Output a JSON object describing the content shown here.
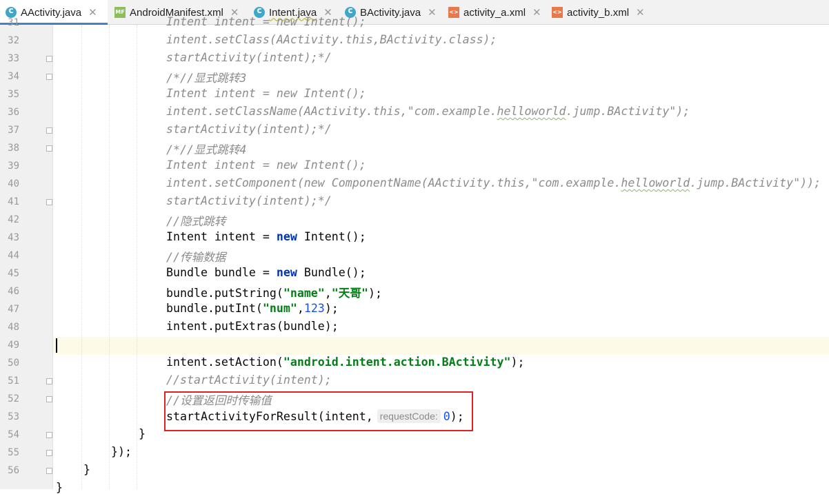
{
  "tabs": [
    {
      "label": "AActivity.java",
      "icon": "java-class-icon",
      "active": true
    },
    {
      "label": "AndroidManifest.xml",
      "icon": "manifest-file-icon",
      "active": false
    },
    {
      "label": "Intent.java",
      "icon": "java-class-icon",
      "active": false
    },
    {
      "label": "BActivity.java",
      "icon": "java-class-icon",
      "active": false
    },
    {
      "label": "activity_a.xml",
      "icon": "xml-layout-icon",
      "active": false
    },
    {
      "label": "activity_b.xml",
      "icon": "xml-layout-icon",
      "active": false
    }
  ],
  "close_glyph": "✕",
  "line_numbers": [
    "31",
    "32",
    "33",
    "34",
    "35",
    "36",
    "37",
    "38",
    "39",
    "40",
    "41",
    "42",
    "43",
    "44",
    "45",
    "46",
    "47",
    "48",
    "49",
    "50",
    "51",
    "52",
    "53",
    "54",
    "55",
    "56"
  ],
  "code": {
    "l31": "Intent intent = new Intent();",
    "l32": "intent.setClass(AActivity.this,BActivity.class);",
    "l33": "startActivity(intent);*/",
    "l34": "/*//显式跳转3",
    "l35": "Intent intent = new Intent();",
    "l36a": "intent.setClassName(AActivity.this,\"com.example.",
    "l36b": "helloworld",
    "l36c": ".jump.BActivity\");",
    "l37": "startActivity(intent);*/",
    "l38": "/*//显式跳转4",
    "l39": "Intent intent = new Intent();",
    "l40a": "intent.setComponent(new ComponentName(AActivity.this,\"com.example.",
    "l40b": "helloworld",
    "l40c": ".jump.BActivity\"));",
    "l41": "startActivity(intent);*/",
    "l42": "//隐式跳转",
    "l43a": "Intent intent = ",
    "l43b": "new",
    "l43c": " Intent();",
    "l44": "//传输数据",
    "l45a": "Bundle bundle = ",
    "l45b": "new",
    "l45c": " Bundle();",
    "l46a": "bundle.putString(",
    "l46b": "\"name\"",
    "l46c": ",",
    "l46d": "\"天哥\"",
    "l46e": ");",
    "l47a": "bundle.putInt(",
    "l47b": "\"num\"",
    "l47c": ",",
    "l47d": "123",
    "l47e": ");",
    "l48": "intent.putExtras(bundle);",
    "l50a": "intent.setAction(",
    "l50b": "\"android.intent.action.BActivity\"",
    "l50c": ");",
    "l51": "//startActivity(intent);",
    "l52": "//设置返回时传输值",
    "l53a": "startActivityForResult(intent,",
    "l53hint": "requestCode:",
    "l53b": "0",
    "l53c": ");",
    "l54": "}",
    "l55": "});",
    "l56": "}",
    "l57": "}"
  },
  "colors": {
    "keyword": "#0033b3",
    "string": "#067d17",
    "number": "#1750eb",
    "comment": "#8c8c8c",
    "highlight_box": "#e02020",
    "active_tab_underline": "#4083c9"
  }
}
